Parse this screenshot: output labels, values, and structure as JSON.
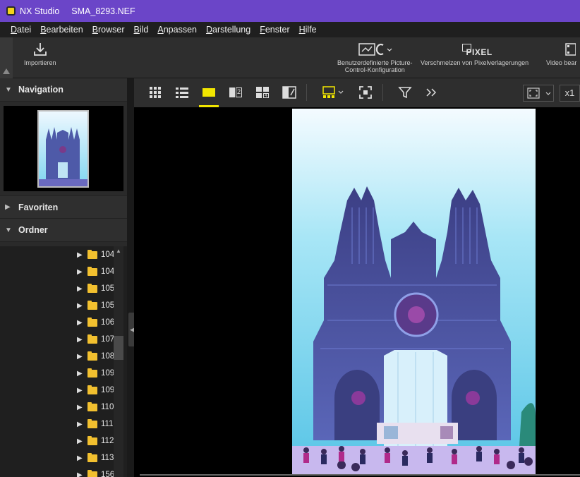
{
  "titlebar": {
    "app_name": "NX Studio",
    "file_name": "SMA_8293.NEF"
  },
  "menu": [
    {
      "hot": "D",
      "rest": "atei"
    },
    {
      "hot": "B",
      "rest": "earbeiten"
    },
    {
      "hot": "B",
      "rest": "rowser"
    },
    {
      "hot": "B",
      "rest": "ild"
    },
    {
      "hot": "A",
      "rest": "npassen"
    },
    {
      "hot": "D",
      "rest": "arstellung"
    },
    {
      "hot": "F",
      "rest": "enster"
    },
    {
      "hot": "H",
      "rest": "ilfe"
    }
  ],
  "toolbar": {
    "import_label": "Importieren",
    "picture_control_label_1": "Benutzerdefinierte Picture-",
    "picture_control_label_2": "Control-Konfiguration",
    "pixel_shift_label": "Verschmelzen von Pixelverlagerungen",
    "pixel_icon_text": "PIXEL",
    "video_label": "Video bear"
  },
  "panels": {
    "navigation": "Navigation",
    "favorites": "Favoriten",
    "folders": "Ordner"
  },
  "folders": [
    "104",
    "104",
    "105",
    "105",
    "106",
    "107",
    "108",
    "109",
    "109",
    "110",
    "111",
    "112",
    "113",
    "156"
  ],
  "viewbar": {
    "zoom_label": "x1",
    "compare_2": "2",
    "compare_4": "4"
  },
  "colors": {
    "titlebar": "#6b45c8",
    "accent_yellow": "#f2e600",
    "folder": "#f2c02f"
  }
}
